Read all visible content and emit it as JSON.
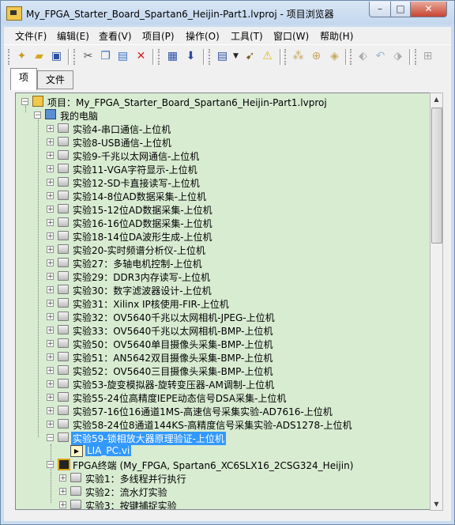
{
  "window": {
    "title": "My_FPGA_Starter_Board_Spartan6_Heijin-Part1.lvproj - 项目浏览器",
    "controls": {
      "minimize": "–",
      "maximize": "□",
      "close": "✕"
    }
  },
  "menu": [
    "文件(F)",
    "编辑(E)",
    "查看(V)",
    "项目(P)",
    "操作(O)",
    "工具(T)",
    "窗口(W)",
    "帮助(H)"
  ],
  "toolbar": {
    "icons": [
      "new-icon",
      "open-icon",
      "save-all-icon",
      "cut-icon",
      "copy-icon",
      "paste-icon",
      "delete-icon",
      "build-icon",
      "deploy-icon",
      "view-icon",
      "dropdown-icon",
      "pointer-icon",
      "warning-icon",
      "tool1-icon",
      "tool2-icon",
      "tool3-icon",
      "tool4-icon",
      "undo-icon",
      "redo-icon",
      "tool5-icon"
    ]
  },
  "tabs": [
    "项",
    "文件"
  ],
  "tree": {
    "project": "项目：My_FPGA_Starter_Board_Spartan6_Heijin-Part1.lvproj",
    "computer": "我的电脑",
    "items": [
      "实验4-串口通信-上位机",
      "实验8-USB通信-上位机",
      "实验9-千兆以太网通信-上位机",
      "实验11-VGA字符显示-上位机",
      "实验12-SD卡直接读写-上位机",
      "实验14-8位AD数据采集-上位机",
      "实验15-12位AD数据采集-上位机",
      "实验16-16位AD数据采集-上位机",
      "实验18-14位DA波形生成-上位机",
      "实验20-实时频谱分析仪-上位机",
      "实验27：多轴电机控制-上位机",
      "实验29：DDR3内存读写-上位机",
      "实验30：数字滤波器设计-上位机",
      "实验31：Xilinx IP核使用-FIR-上位机",
      "实验32：OV5640千兆以太网相机-JPEG-上位机",
      "实验33：OV5640千兆以太网相机-BMP-上位机",
      "实验50：OV5640单目摄像头采集-BMP-上位机",
      "实验51：AN5642双目摄像头采集-BMP-上位机",
      "实验52：OV5640三目摄像头采集-BMP-上位机",
      "实验53-旋变模拟器-旋转变压器-AM调制-上位机",
      "实验55-24位高精度IEPE动态信号DSA采集-上位机",
      "实验57-16位16通道1MS-高速信号采集实验-AD7616-上位机",
      "实验58-24位8通道144KS-高精度信号采集实验-ADS1278-上位机"
    ],
    "selected_folder": "实验59-锁相放大器原理验证-上位机",
    "selected_child": "LIA_PC.vi",
    "fpga_target": "FPGA终端 (My_FPGA, Spartan6_XC6SLX16_2CSG324_Heijin)",
    "fpga_items": [
      "实验1：多线程并行执行",
      "实验2：流水灯实验",
      "实验3：按键捕捉实验"
    ]
  }
}
